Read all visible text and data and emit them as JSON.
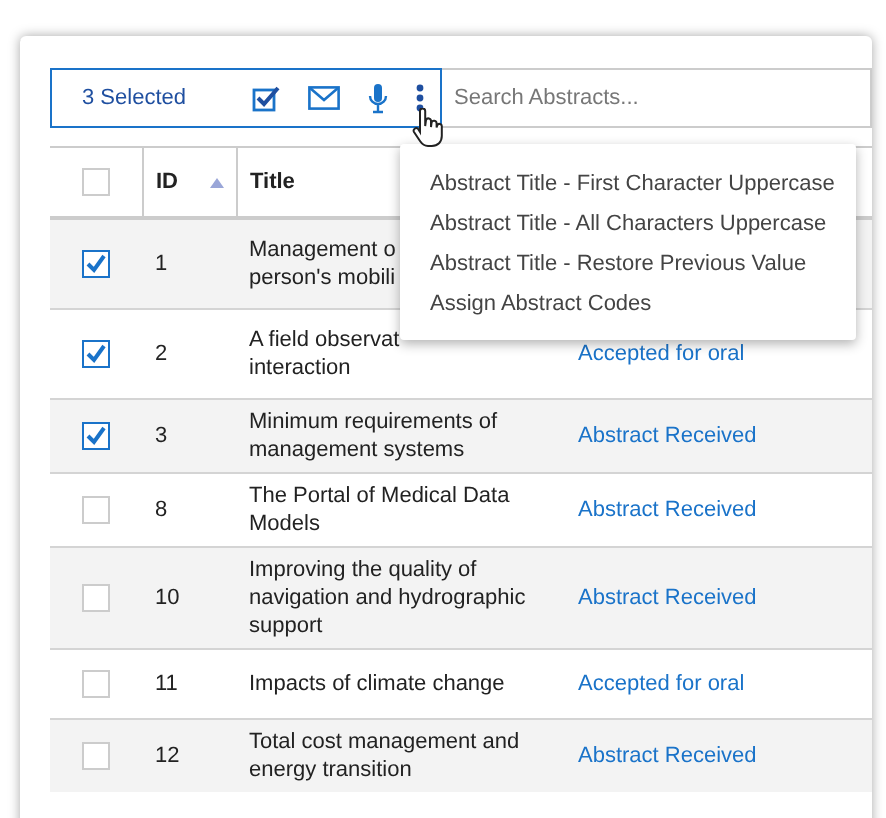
{
  "toolbar": {
    "selected_count": "3 Selected",
    "search": {
      "placeholder": "Search Abstracts..."
    }
  },
  "table": {
    "header_checked": false,
    "columns": [
      {
        "label": "ID",
        "sorted": true
      },
      {
        "label": "Title"
      }
    ],
    "rows": [
      {
        "checked": true,
        "id": "1",
        "title": "Management o\nperson's mobili"
      },
      {
        "checked": true,
        "id": "2",
        "title": "A field observat\ninteraction",
        "status": "Accepted for oral"
      },
      {
        "checked": true,
        "id": "3",
        "title": "Minimum requirements of management systems",
        "status": "Abstract Received"
      },
      {
        "checked": false,
        "id": "8",
        "title": "The Portal of Medical Data Models",
        "status": "Abstract Received"
      },
      {
        "checked": false,
        "id": "10",
        "title": "Improving the quality of navigation and hydrographic support",
        "status": "Abstract Received"
      },
      {
        "checked": false,
        "id": "11",
        "title": "Impacts of climate change",
        "status": "Accepted for oral"
      },
      {
        "checked": false,
        "id": "12",
        "title": "Total cost management and energy transition",
        "status": "Abstract Received"
      }
    ]
  },
  "menu": {
    "items": [
      "Abstract Title - First Character Uppercase",
      "Abstract Title - All Characters Uppercase",
      "Abstract Title - Restore Previous Value",
      "Assign Abstract Codes"
    ]
  }
}
